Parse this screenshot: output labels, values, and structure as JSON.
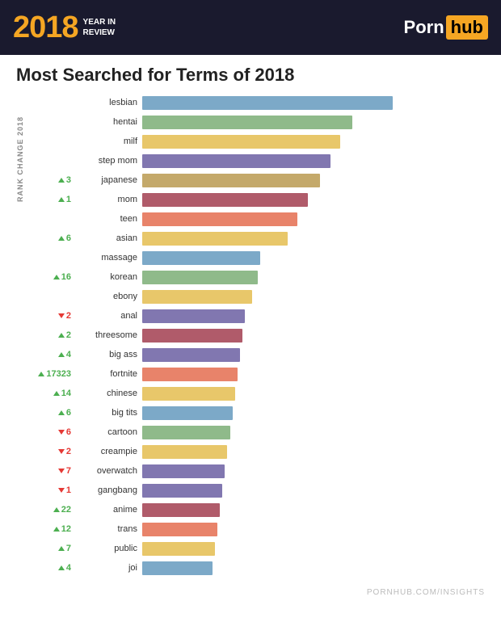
{
  "header": {
    "year": "2018",
    "year_sub": "YEAR IN\nREVIEW",
    "logo_porn": "Porn",
    "logo_hub": "hub"
  },
  "title": "Most Searched for Terms of 2018",
  "rank_axis_label": "RANK CHANGE 2018",
  "footer": "PORNHUB.COM/INSIGHTS",
  "bars": [
    {
      "label": "lesbian",
      "rank_change": "",
      "direction": "",
      "pct": 100,
      "color": "#7ca9c8"
    },
    {
      "label": "hentai",
      "rank_change": "",
      "direction": "",
      "pct": 84,
      "color": "#8fba8a"
    },
    {
      "label": "milf",
      "rank_change": "",
      "direction": "",
      "pct": 79,
      "color": "#e8c76a"
    },
    {
      "label": "step mom",
      "rank_change": "",
      "direction": "",
      "pct": 75,
      "color": "#8177b0"
    },
    {
      "label": "japanese",
      "rank_change": "3",
      "direction": "up",
      "pct": 71,
      "color": "#c4a96a"
    },
    {
      "label": "mom",
      "rank_change": "1",
      "direction": "up",
      "pct": 66,
      "color": "#b05b6a"
    },
    {
      "label": "teen",
      "rank_change": "",
      "direction": "",
      "pct": 62,
      "color": "#e8836a"
    },
    {
      "label": "asian",
      "rank_change": "6",
      "direction": "up",
      "pct": 58,
      "color": "#e8c76a"
    },
    {
      "label": "massage",
      "rank_change": "",
      "direction": "",
      "pct": 47,
      "color": "#7ca9c8"
    },
    {
      "label": "korean",
      "rank_change": "16",
      "direction": "up",
      "pct": 46,
      "color": "#8fba8a"
    },
    {
      "label": "ebony",
      "rank_change": "",
      "direction": "",
      "pct": 44,
      "color": "#e8c76a"
    },
    {
      "label": "anal",
      "rank_change": "2",
      "direction": "dn",
      "pct": 41,
      "color": "#8177b0"
    },
    {
      "label": "threesome",
      "rank_change": "2",
      "direction": "up",
      "pct": 40,
      "color": "#b05b6a"
    },
    {
      "label": "big ass",
      "rank_change": "4",
      "direction": "up",
      "pct": 39,
      "color": "#8177b0"
    },
    {
      "label": "fortnite",
      "rank_change": "17323",
      "direction": "up",
      "pct": 38,
      "color": "#e8836a"
    },
    {
      "label": "chinese",
      "rank_change": "14",
      "direction": "up",
      "pct": 37,
      "color": "#e8c76a"
    },
    {
      "label": "big tits",
      "rank_change": "6",
      "direction": "up",
      "pct": 36,
      "color": "#7ca9c8"
    },
    {
      "label": "cartoon",
      "rank_change": "6",
      "direction": "dn",
      "pct": 35,
      "color": "#8fba8a"
    },
    {
      "label": "creampie",
      "rank_change": "2",
      "direction": "dn",
      "pct": 34,
      "color": "#e8c76a"
    },
    {
      "label": "overwatch",
      "rank_change": "7",
      "direction": "dn",
      "pct": 33,
      "color": "#8177b0"
    },
    {
      "label": "gangbang",
      "rank_change": "1",
      "direction": "dn",
      "pct": 32,
      "color": "#8177b0"
    },
    {
      "label": "anime",
      "rank_change": "22",
      "direction": "up",
      "pct": 31,
      "color": "#b05b6a"
    },
    {
      "label": "trans",
      "rank_change": "12",
      "direction": "up",
      "pct": 30,
      "color": "#e8836a"
    },
    {
      "label": "public",
      "rank_change": "7",
      "direction": "up",
      "pct": 29,
      "color": "#e8c76a"
    },
    {
      "label": "joi",
      "rank_change": "4",
      "direction": "up",
      "pct": 28,
      "color": "#7ca9c8"
    }
  ]
}
